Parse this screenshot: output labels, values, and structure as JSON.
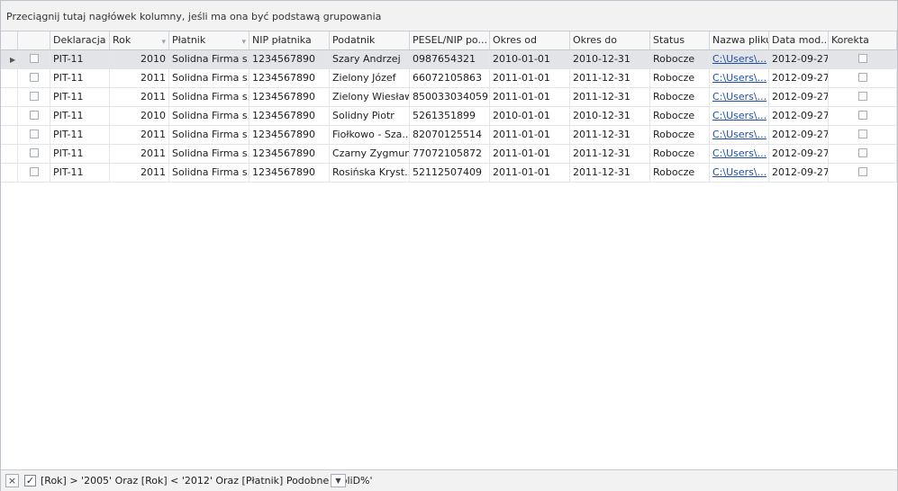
{
  "group_panel_hint": "Przeciągnij tutaj nagłówek kolumny, jeśli ma ona być podstawą grupowania",
  "columns": [
    "Deklaracja",
    "Rok",
    "Płatnik",
    "NIP płatnika",
    "Podatnik",
    "PESEL/NIP po...",
    "Okres od",
    "Okres do",
    "Status",
    "Nazwa pliku",
    "Data mod...",
    "Korekta"
  ],
  "filter_icon": "▾",
  "row_indicator_icon": "▶",
  "rows": [
    {
      "deklaracja": "PIT-11",
      "rok": "2010",
      "platnik": "Solidna Firma s...",
      "nip": "1234567890",
      "podatnik": "Szary Andrzej",
      "pesel": "0987654321",
      "okres_od": "2010-01-01",
      "okres_do": "2010-12-31",
      "status": "Robocze",
      "plik": "C:\\Users\\...",
      "data_mod": "2012-09-27"
    },
    {
      "deklaracja": "PIT-11",
      "rok": "2011",
      "platnik": "Solidna Firma s...",
      "nip": "1234567890",
      "podatnik": "Zielony Józef",
      "pesel": "66072105863",
      "okres_od": "2011-01-01",
      "okres_do": "2011-12-31",
      "status": "Robocze",
      "plik": "C:\\Users\\...",
      "data_mod": "2012-09-27"
    },
    {
      "deklaracja": "PIT-11",
      "rok": "2011",
      "platnik": "Solidna Firma s...",
      "nip": "1234567890",
      "podatnik": "Zielony Wiesław",
      "pesel": "850033034059",
      "okres_od": "2011-01-01",
      "okres_do": "2011-12-31",
      "status": "Robocze",
      "plik": "C:\\Users\\...",
      "data_mod": "2012-09-27"
    },
    {
      "deklaracja": "PIT-11",
      "rok": "2010",
      "platnik": "Solidna Firma s...",
      "nip": "1234567890",
      "podatnik": "Solidny Piotr",
      "pesel": "5261351899",
      "okres_od": "2010-01-01",
      "okres_do": "2010-12-31",
      "status": "Robocze",
      "plik": "C:\\Users\\...",
      "data_mod": "2012-09-27"
    },
    {
      "deklaracja": "PIT-11",
      "rok": "2011",
      "platnik": "Solidna Firma s...",
      "nip": "1234567890",
      "podatnik": "Fiołkowo - Sza...",
      "pesel": "82070125514",
      "okres_od": "2011-01-01",
      "okres_do": "2011-12-31",
      "status": "Robocze",
      "plik": "C:\\Users\\...",
      "data_mod": "2012-09-27"
    },
    {
      "deklaracja": "PIT-11",
      "rok": "2011",
      "platnik": "Solidna Firma s...",
      "nip": "1234567890",
      "podatnik": "Czarny Zygmunt",
      "pesel": "77072105872",
      "okres_od": "2011-01-01",
      "okres_do": "2011-12-31",
      "status": "Robocze",
      "plik": "C:\\Users\\...",
      "data_mod": "2012-09-27"
    },
    {
      "deklaracja": "PIT-11",
      "rok": "2011",
      "platnik": "Solidna Firma s...",
      "nip": "1234567890",
      "podatnik": "Rosińska Kryst...",
      "pesel": "52112507409",
      "okres_od": "2011-01-01",
      "okres_do": "2011-12-31",
      "status": "Robocze",
      "plik": "C:\\Users\\...",
      "data_mod": "2012-09-27"
    }
  ],
  "filter_bar": {
    "close_icon": "×",
    "enabled_check": "✓",
    "text": "[Rok] > '2005' Oraz [Rok] < '2012' Oraz [Płatnik] Podobne 'SoliD%'",
    "dropdown_icon": "▼"
  }
}
